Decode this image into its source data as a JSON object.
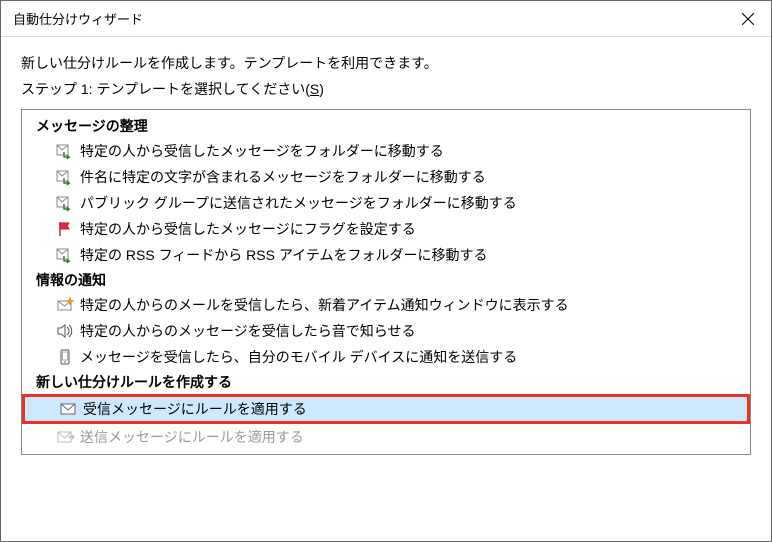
{
  "window": {
    "title": "自動仕分けウィザード"
  },
  "intro": "新しい仕分けルールを作成します。テンプレートを利用できます。",
  "step_prefix": "ステップ 1: テンプレートを選択してください(",
  "step_hotkey": "S",
  "step_suffix": ")",
  "groups": {
    "organize": {
      "header": "メッセージの整理",
      "items": [
        "特定の人から受信したメッセージをフォルダーに移動する",
        "件名に特定の文字が含まれるメッセージをフォルダーに移動する",
        "パブリック グループに送信されたメッセージをフォルダーに移動する",
        "特定の人から受信したメッセージにフラグを設定する",
        "特定の RSS フィードから RSS アイテムをフォルダーに移動する"
      ]
    },
    "notify": {
      "header": "情報の通知",
      "items": [
        "特定の人からのメールを受信したら、新着アイテム通知ウィンドウに表示する",
        "特定の人からのメッセージを受信したら音で知らせる",
        "メッセージを受信したら、自分のモバイル デバイスに通知を送信する"
      ]
    },
    "create": {
      "header": "新しい仕分けルールを作成する",
      "items": [
        "受信メッセージにルールを適用する",
        "送信メッセージにルールを適用する"
      ]
    }
  }
}
